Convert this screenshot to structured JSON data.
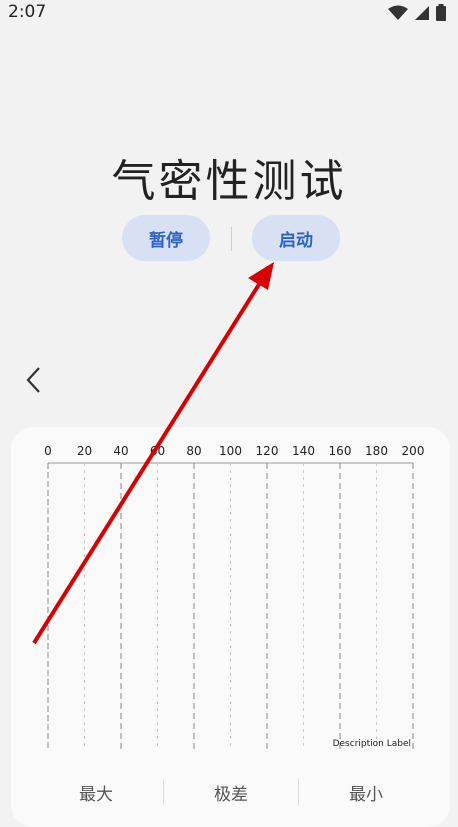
{
  "status": {
    "time": "2:07"
  },
  "title": "气密性测试",
  "buttons": {
    "pause": "暂停",
    "start": "启动"
  },
  "chart_data": {
    "type": "line",
    "x_ticks": [
      "0",
      "20",
      "40",
      "60",
      "80",
      "100",
      "120",
      "140",
      "160",
      "180",
      "200"
    ],
    "x_range": [
      0,
      200
    ],
    "description_label": "Description Label",
    "series": []
  },
  "stats": {
    "max": "最大",
    "range": "极差",
    "min": "最小"
  }
}
